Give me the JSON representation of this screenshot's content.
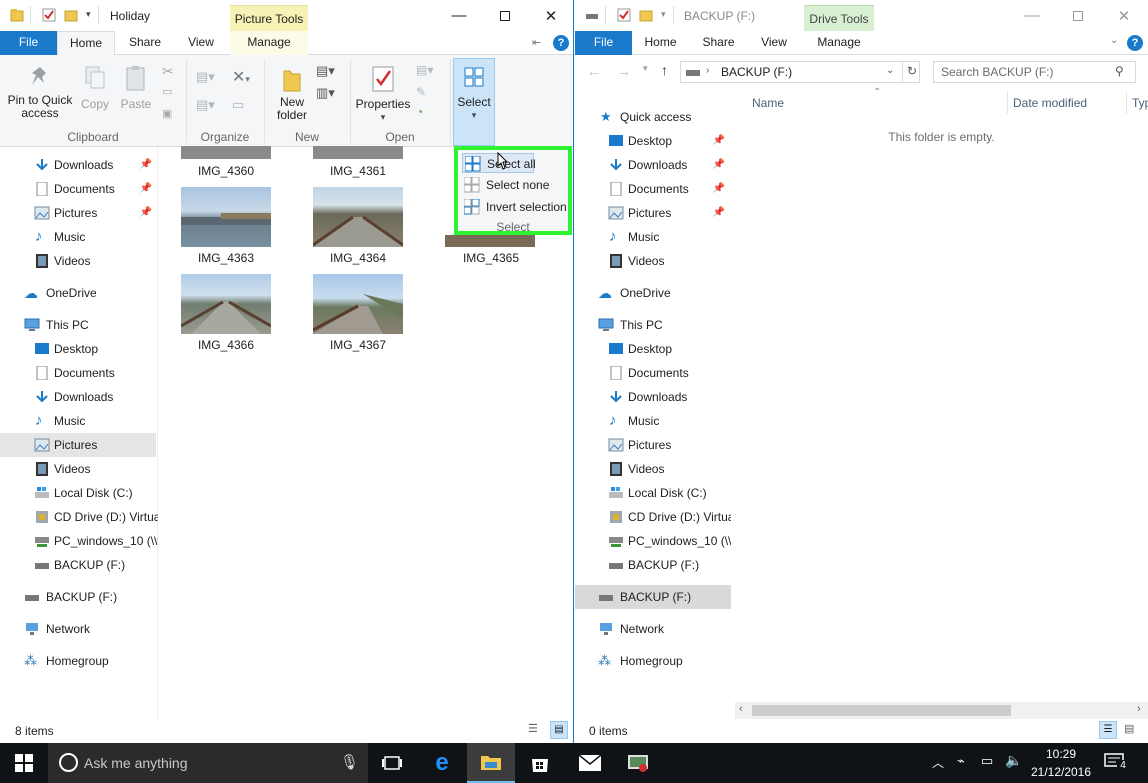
{
  "left": {
    "title": "Holiday",
    "context_tab": "Picture Tools",
    "tabs": {
      "file": "File",
      "home": "Home",
      "share": "Share",
      "view": "View",
      "manage": "Manage"
    },
    "ribbon": {
      "pin_to_quick_access": "Pin to Quick access",
      "copy": "Copy",
      "paste": "Paste",
      "new_folder": "New folder",
      "properties": "Properties",
      "select": "Select",
      "groups": {
        "clipboard": "Clipboard",
        "organize": "Organize",
        "new": "New",
        "open": "Open"
      }
    },
    "nav": [
      {
        "label": "Downloads"
      },
      {
        "label": "Documents"
      },
      {
        "label": "Pictures"
      },
      {
        "label": "Music"
      },
      {
        "label": "Videos"
      },
      {
        "label": "OneDrive"
      },
      {
        "label": "This PC"
      },
      {
        "label": "Desktop"
      },
      {
        "label": "Documents"
      },
      {
        "label": "Downloads"
      },
      {
        "label": "Music"
      },
      {
        "label": "Pictures"
      },
      {
        "label": "Videos"
      },
      {
        "label": "Local Disk (C:)"
      },
      {
        "label": "CD Drive (D:) Virtua"
      },
      {
        "label": "PC_windows_10 (\\\\v"
      },
      {
        "label": "BACKUP (F:)"
      },
      {
        "label": "BACKUP (F:)"
      },
      {
        "label": "Network"
      },
      {
        "label": "Homegroup"
      }
    ],
    "files": [
      {
        "name": "IMG_4360"
      },
      {
        "name": "IMG_4361"
      },
      {
        "name": "IMG_4363"
      },
      {
        "name": "IMG_4364"
      },
      {
        "name": "IMG_4365"
      },
      {
        "name": "IMG_4366"
      },
      {
        "name": "IMG_4367"
      }
    ],
    "dropdown": {
      "select_all": "Select all",
      "select_none": "Select none",
      "invert_selection": "Invert selection",
      "group": "Select"
    },
    "status": "8 items"
  },
  "right": {
    "title": "BACKUP (F:)",
    "context_tab": "Drive Tools",
    "tabs": {
      "file": "File",
      "home": "Home",
      "share": "Share",
      "view": "View",
      "manage": "Manage"
    },
    "address": "BACKUP (F:)",
    "search_placeholder": "Search BACKUP (F:)",
    "columns": {
      "name": "Name",
      "date": "Date modified",
      "type": "Typ"
    },
    "empty": "This folder is empty.",
    "nav": [
      {
        "label": "Quick access"
      },
      {
        "label": "Desktop"
      },
      {
        "label": "Downloads"
      },
      {
        "label": "Documents"
      },
      {
        "label": "Pictures"
      },
      {
        "label": "Music"
      },
      {
        "label": "Videos"
      },
      {
        "label": "OneDrive"
      },
      {
        "label": "This PC"
      },
      {
        "label": "Desktop"
      },
      {
        "label": "Documents"
      },
      {
        "label": "Downloads"
      },
      {
        "label": "Music"
      },
      {
        "label": "Pictures"
      },
      {
        "label": "Videos"
      },
      {
        "label": "Local Disk (C:)"
      },
      {
        "label": "CD Drive (D:) Virtua"
      },
      {
        "label": "PC_windows_10 (\\\\v"
      },
      {
        "label": "BACKUP (F:)"
      },
      {
        "label": "BACKUP (F:)"
      },
      {
        "label": "Network"
      },
      {
        "label": "Homegroup"
      }
    ],
    "status": "0 items"
  },
  "taskbar": {
    "search_placeholder": "Ask me anything",
    "time": "10:29",
    "date": "21/12/2016",
    "notifications": "4"
  },
  "colors": {
    "accent": "#1979ca",
    "highlight": "#2ef32e",
    "taskbar": "#101316"
  }
}
